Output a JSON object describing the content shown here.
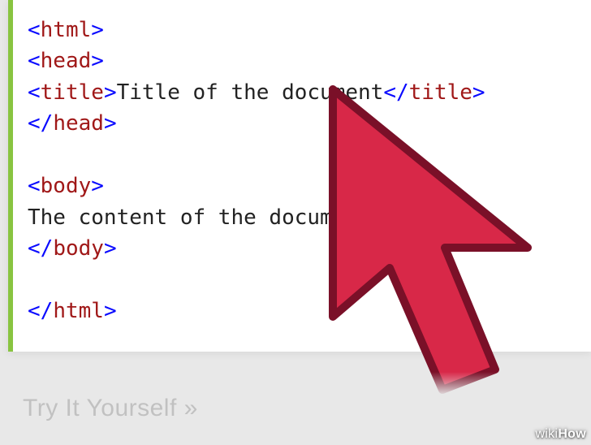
{
  "code": {
    "lines": [
      {
        "type": "tag-open",
        "name": "html"
      },
      {
        "type": "tag-open",
        "name": "head"
      },
      {
        "type": "tag-wrap",
        "name": "title",
        "text": "Title of the document"
      },
      {
        "type": "tag-close",
        "name": "head"
      },
      {
        "type": "blank"
      },
      {
        "type": "tag-open",
        "name": "body"
      },
      {
        "type": "text",
        "text": "The content of the document......"
      },
      {
        "type": "tag-close",
        "name": "body"
      },
      {
        "type": "blank"
      },
      {
        "type": "tag-close",
        "name": "html"
      }
    ]
  },
  "ghost_caption": "Try It Yourself »",
  "watermark_prefix": "wiki",
  "watermark_suffix": "How",
  "colors": {
    "accent_green": "#88c440",
    "cursor_fill": "#d82848",
    "cursor_stroke": "#7a1028",
    "tag_bracket": "#0a0aff",
    "tag_name": "#a01818"
  }
}
